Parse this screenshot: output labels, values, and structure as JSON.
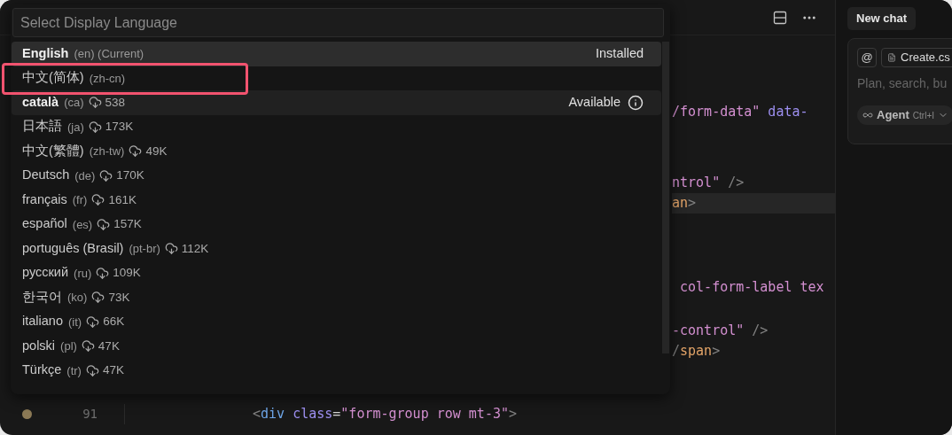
{
  "editor": {
    "toolbar": {
      "buttons": [
        {
          "kind": "layout"
        },
        {
          "kind": "more"
        }
      ]
    },
    "tail_lines": [
      {
        "current": false,
        "tokens": [
          {
            "kind": "string",
            "text": "/form-data\""
          },
          {
            "kind": "attr",
            "text": " data-"
          }
        ]
      },
      {
        "current": false,
        "tokens": [
          {
            "kind": "string",
            "text": "ntrol\""
          },
          {
            "kind": "punct",
            "text": " />"
          }
        ]
      },
      {
        "current": true,
        "tokens": [
          {
            "kind": "inline-tag",
            "text": "an"
          },
          {
            "kind": "punct",
            "text": ">"
          }
        ]
      },
      {
        "current": false,
        "tokens": [
          {
            "kind": "string",
            "text": " col-form-label tex"
          }
        ]
      },
      {
        "current": false,
        "tokens": [
          {
            "kind": "string",
            "text": "-control\""
          },
          {
            "kind": "punct",
            "text": " />"
          }
        ]
      },
      {
        "current": false,
        "tokens": [
          {
            "kind": "punct",
            "text": "/"
          },
          {
            "kind": "inline-tag",
            "text": "span"
          },
          {
            "kind": "punct",
            "text": ">"
          }
        ]
      }
    ],
    "lines": [
      {
        "number": "91",
        "modified": true,
        "tokens": [
          {
            "kind": "punct",
            "text": "<"
          },
          {
            "kind": "tag",
            "text": "div"
          },
          {
            "kind": "attr",
            "text": " class"
          },
          {
            "kind": "plain",
            "text": "="
          },
          {
            "kind": "string",
            "text": "\"form-group row mt-3\""
          },
          {
            "kind": "punct",
            "text": ">"
          }
        ]
      }
    ]
  },
  "quick_pick": {
    "placeholder": "Select Display Language",
    "items": [
      {
        "name": "English",
        "code": "(en) (Current)",
        "selected": true,
        "hovered": false,
        "outlined": false,
        "status": "Installed"
      },
      {
        "name": "中文(简体)",
        "code": "(zh-cn)",
        "selected": false,
        "hovered": false,
        "outlined": true
      },
      {
        "name": "català",
        "code": "(ca)",
        "size": "538",
        "selected": false,
        "hovered": true,
        "outlined": false,
        "status": "Available",
        "info": true
      },
      {
        "name": "日本語",
        "code": "(ja)",
        "size": "173K",
        "selected": false,
        "hovered": false,
        "outlined": false
      },
      {
        "name": "中文(繁體)",
        "code": "(zh-tw)",
        "size": "49K",
        "selected": false,
        "hovered": false,
        "outlined": false
      },
      {
        "name": "Deutsch",
        "code": "(de)",
        "size": "170K",
        "selected": false,
        "hovered": false,
        "outlined": false
      },
      {
        "name": "français",
        "code": "(fr)",
        "size": "161K",
        "selected": false,
        "hovered": false,
        "outlined": false
      },
      {
        "name": "español",
        "code": "(es)",
        "size": "157K",
        "selected": false,
        "hovered": false,
        "outlined": false
      },
      {
        "name": "português (Brasil)",
        "code": "(pt-br)",
        "size": "112K",
        "selected": false,
        "hovered": false,
        "outlined": false
      },
      {
        "name": "русский",
        "code": "(ru)",
        "size": "109K",
        "selected": false,
        "hovered": false,
        "outlined": false
      },
      {
        "name": "한국어",
        "code": "(ko)",
        "size": "73K",
        "selected": false,
        "hovered": false,
        "outlined": false
      },
      {
        "name": "italiano",
        "code": "(it)",
        "size": "66K",
        "selected": false,
        "hovered": false,
        "outlined": false
      },
      {
        "name": "polski",
        "code": "(pl)",
        "size": "47K",
        "selected": false,
        "hovered": false,
        "outlined": false
      },
      {
        "name": "Türkçe",
        "code": "(tr)",
        "size": "47K",
        "selected": false,
        "hovered": false,
        "outlined": false
      }
    ]
  },
  "chat": {
    "new_chat": "New chat",
    "mention": "@",
    "file_chip": "Create.cs",
    "placeholder": "Plan, search, bu",
    "mode": {
      "label": "Agent",
      "shortcut": "Ctrl+I"
    }
  }
}
